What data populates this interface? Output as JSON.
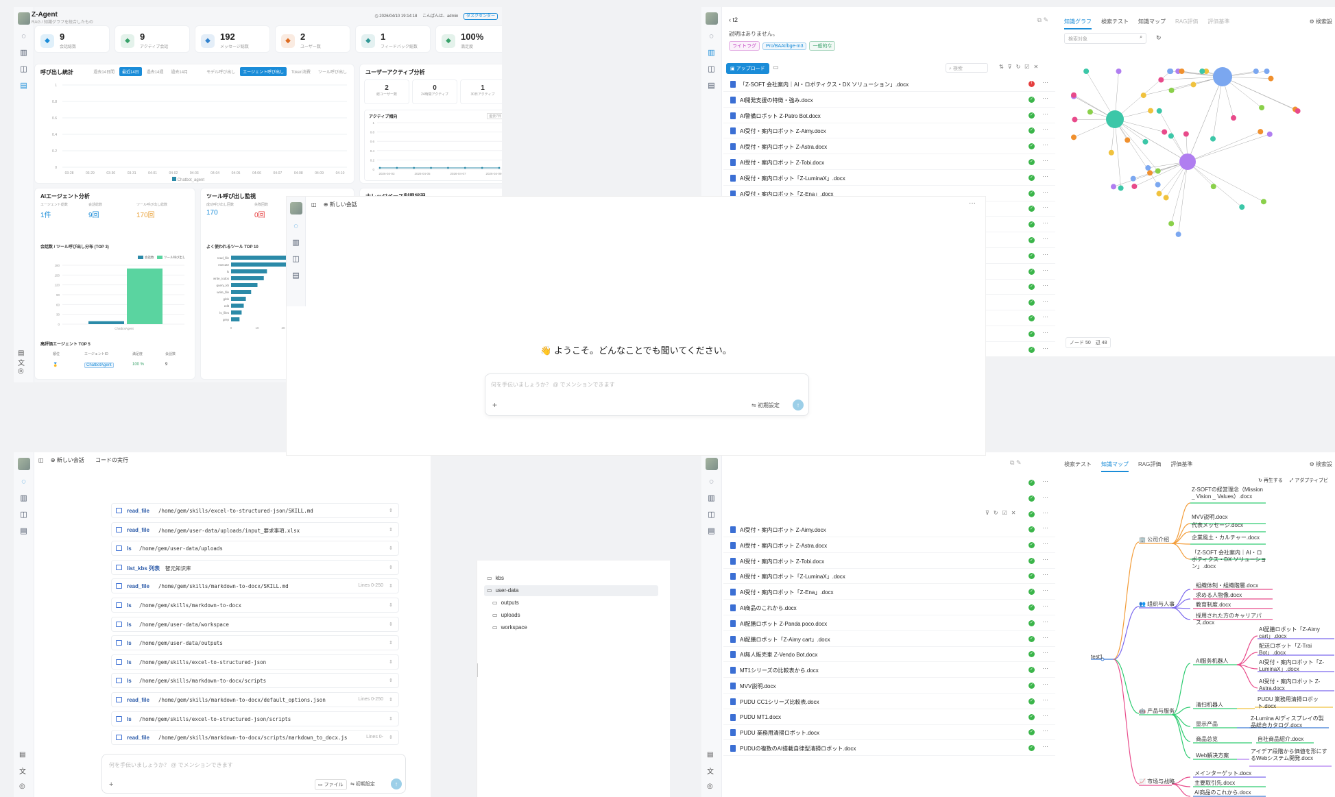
{
  "dashboard": {
    "title": "Z-Agent",
    "subtitle": "RAG / 知識グラフを統合したもの",
    "datetime": "2026/04/10 19:14:18",
    "greeting": "こんばんは、admin",
    "task_center": "タスクセンター",
    "kpis": [
      {
        "value": "9",
        "label": "会話総数",
        "color": "#1a8cd8"
      },
      {
        "value": "9",
        "label": "アクティブ会話",
        "color": "#38a169"
      },
      {
        "value": "192",
        "label": "メッセージ総数",
        "color": "#3182ce"
      },
      {
        "value": "2",
        "label": "ユーザー数",
        "color": "#dd6b20"
      },
      {
        "value": "1",
        "label": "フィードバック総数",
        "color": "#319795"
      },
      {
        "value": "100%",
        "label": "満足度",
        "color": "#38a169"
      }
    ],
    "call_stats": {
      "title": "呼び出し統計",
      "ranges": [
        "過去14日間",
        "最近14日",
        "過去14週",
        "過去14月"
      ],
      "views": [
        "モデル呼び出し",
        "エージェント呼び出し",
        "Token消費",
        "ツール呼び出し"
      ],
      "legend": "Chatbot_agent",
      "yticks": [
        "1",
        "0.8",
        "0.6",
        "0.4",
        "0.2",
        "0"
      ],
      "xticks": [
        "03-28",
        "03-29",
        "03-30",
        "03-31",
        "04-01",
        "04-02",
        "04-03",
        "04-04",
        "04-05",
        "04-06",
        "04-07",
        "04-08",
        "04-09",
        "04-10"
      ]
    },
    "user_activity": {
      "title": "ユーザーアクティブ分析",
      "stats": [
        {
          "value": "2",
          "label": "総ユーザー数"
        },
        {
          "value": "0",
          "label": "24時間アクティブ"
        },
        {
          "value": "1",
          "label": "30日アクティブ"
        }
      ],
      "trend_title": "アクティブ傾向",
      "trend_badge": "過去7日",
      "yticks": [
        "1",
        "0.8",
        "0.6",
        "0.4",
        "0.2",
        "0"
      ],
      "xticks": [
        "2026-04-03",
        "2026-04-05",
        "2026-04-07",
        "2026-04-09"
      ]
    },
    "agent_analysis": {
      "title": "AIエージェント分析",
      "labels": [
        "エージェント総数",
        "会話総数",
        "ツール呼び出し総数"
      ],
      "values": [
        "1件",
        "9回",
        "170回"
      ],
      "chart_title": "会話数 / ツール呼び出し分布 (TOP 3)",
      "legend": [
        "会話数",
        "ツール呼び出し"
      ],
      "yticks": [
        "180",
        "150",
        "120",
        "90",
        "60",
        "30",
        "0"
      ],
      "xlabel": "ChatbotAgent"
    },
    "tool_monitor": {
      "title": "ツール呼び出し監視",
      "labels": [
        "成功呼び出し回数",
        "失敗回数"
      ],
      "values": [
        "170",
        "0回"
      ],
      "chart_title": "よく使われるツール TOP 10",
      "tools": [
        "read_file",
        "execute",
        "ls",
        "write_todos",
        "query_kb",
        "write_file",
        "glob",
        "edit",
        "ls_files",
        "grep"
      ],
      "xticks": [
        "0",
        "10",
        "20",
        "30"
      ]
    },
    "kb_usage": {
      "title": "ナレッジベース利用状況"
    },
    "top_agents": {
      "title": "高評価エージェント TOP 5",
      "headers": [
        "順位",
        "エージェントID",
        "満足度",
        "会話数"
      ],
      "rows": [
        {
          "rank": "🥇",
          "id": "ChatbotAgent",
          "sat": "100 %",
          "count": "9"
        }
      ]
    }
  },
  "kb": {
    "name": "t2",
    "desc": "説明はありません。",
    "tags": [
      "ライトラグ",
      "Pro/BAAI/bge-m3",
      "一般的な"
    ],
    "upload_label": "アップロード",
    "search_placeholder": "検索",
    "files": [
      "「Z-SOFT 会社案内｜AI・ロボティクス・DX ソリューション」.docx",
      "AI開発支援の特徴・強み.docx",
      "AI警備ロボット Z-Patro Bot.docx",
      "AI受付・案内ロボット Z-Aimy.docx",
      "AI受付・案内ロボット Z-Astra.docx",
      "AI受付・案内ロボット Z-Tobi.docx",
      "AI受付・案内ロボット「Z-LuminaX」.docx",
      "AI受付・案内ロボット「Z-Ena」.docx"
    ],
    "tabs": [
      "知識グラフ",
      "検索テスト",
      "知識マップ",
      "RAG評価",
      "評価基準"
    ],
    "graph_search_placeholder": "検索対象",
    "graph_stats": "ノード 50　辺 48",
    "settings_label": "検索設"
  },
  "chat": {
    "new_chat": "新しい会話",
    "welcome": "👋 ようこそ。どんなことでも聞いてください。",
    "placeholder": "何を手伝いましょうか？ @ でメンションできます",
    "settings": "初期設定"
  },
  "code": {
    "new_chat": "新しい会話",
    "run_code": "コードの実行",
    "steps": [
      {
        "tool": "read_file",
        "path": "/home/gem/skills/excel-to-structured-json/SKILL.md",
        "range": ""
      },
      {
        "tool": "read_file",
        "path": "/home/gem/user-data/uploads/input_要求事項.xlsx",
        "range": ""
      },
      {
        "tool": "ls",
        "path": "/home/gem/user-data/uploads",
        "range": ""
      },
      {
        "tool": "list_kbs 列表",
        "path": "智元知识库",
        "range": ""
      },
      {
        "tool": "read_file",
        "path": "/home/gem/skills/markdown-to-docx/SKILL.md",
        "range": "Lines 0-250"
      },
      {
        "tool": "ls",
        "path": "/home/gem/skills/markdown-to-docx",
        "range": ""
      },
      {
        "tool": "ls",
        "path": "/home/gem/user-data/workspace",
        "range": ""
      },
      {
        "tool": "ls",
        "path": "/home/gem/user-data/outputs",
        "range": ""
      },
      {
        "tool": "ls",
        "path": "/home/gem/skills/excel-to-structured-json",
        "range": ""
      },
      {
        "tool": "ls",
        "path": "/home/gem/skills/markdown-to-docx/scripts",
        "range": ""
      },
      {
        "tool": "read_file",
        "path": "/home/gem/skills/markdown-to-docx/default_options.json",
        "range": "Lines 0-250"
      },
      {
        "tool": "ls",
        "path": "/home/gem/skills/excel-to-structured-json/scripts",
        "range": ""
      },
      {
        "tool": "read_file",
        "path": "/home/gem/skills/markdown-to-docx/scripts/markdown_to_docx.js",
        "range": "Lines 0-"
      }
    ],
    "placeholder": "何を手伝いましょうか？ @ でメンションできます",
    "file_btn": "ファイル",
    "settings": "初期設定",
    "tree": [
      "kbs",
      "user-data",
      "outputs",
      "uploads",
      "workspace"
    ]
  },
  "kb2": {
    "files": [
      "AI受付・案内ロボット Z-Aimy.docx",
      "AI受付・案内ロボット Z-Astra.docx",
      "AI受付・案内ロボット Z-Tobi.docx",
      "AI受付・案内ロボット「Z-LuminaX」.docx",
      "AI受付・案内ロボット「Z-Ena」.docx",
      "AI商品のこれから.docx",
      "AI配膳ロボット Z-Panda poco.docx",
      "AI配膳ロボット「Z-Aimy cart」.docx",
      "AI無人販売車 Z-Vendo Bot.docx",
      "MT1シリーズの比較表から.docx",
      "MVV説明.docx",
      "PUDU CC1シリーズ比較表.docx",
      "PUDU MT1.docx",
      "PUDU 業務用清掃ロボット.docx",
      "PUDUの複数のAI搭載自律型清掃ロボット.docx"
    ],
    "tabs": [
      "検索テスト",
      "知識マップ",
      "RAG評価",
      "評価基準"
    ],
    "regen": "再生する",
    "adaptive": "アダプティブビ",
    "settings_label": "検索設",
    "mindmap": {
      "root": "test1",
      "b1": "🏢 公司介绍",
      "b2": "👥 组织与人事",
      "b3": "🤖 产品与服务",
      "b4": "📈 市场与战略",
      "l1": [
        "Z-SOFTの経営理念（Mission _ Vision _ Values）.docx",
        "MVV説明.docx",
        "代表メッセージ.docx",
        "企業風土・カルチャー.docx",
        "「Z-SOFT 会社案内｜AI・ロボティクス・DX ソリューション」.docx"
      ],
      "l2": [
        "組織体制・組織階層.docx",
        "求める人物像.docx",
        "教育制度.docx",
        "採用された方のキャリアパス.docx"
      ],
      "s3": [
        "AI服务机器人",
        "清扫机器人",
        "显示产品",
        "商品总览",
        "Web解决方案"
      ],
      "l3a": [
        "AI配膳ロボット「Z-Aimy cart」.docx",
        "配送ロボット「Z-Trai Bot」.docx",
        "AI受付・案内ロボット「Z-LuminaX」.docx",
        "AI受付・案内ロボット Z-Astra.docx"
      ],
      "l3b": "PUDU 業務用清掃ロボット.docx",
      "l3c": "Z-Lumina AIディスプレイの製品総合カタログ.docx",
      "l3d": "自社商品紹介.docx",
      "l3e": "アイデア段階から価値を形にするWebシステム開発.docx",
      "l4": [
        "メインターゲット.docx",
        "主要取引先.docx",
        "AI商品のこれから.docx"
      ]
    }
  }
}
